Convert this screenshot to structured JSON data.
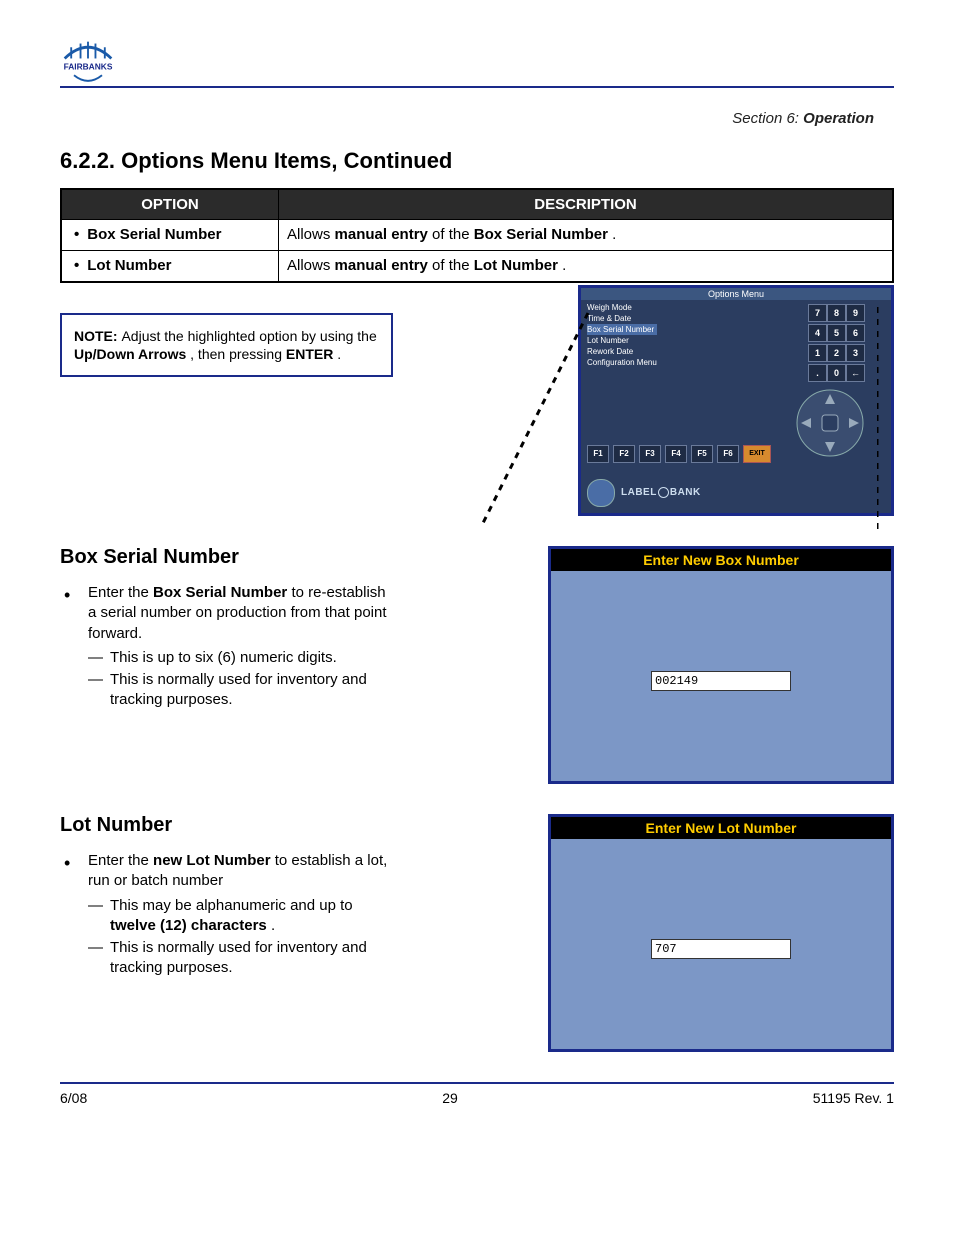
{
  "header": {
    "section": "Section 6:",
    "section_title": "Operation",
    "brand": "FAIRBANKS"
  },
  "options_title": "6.2.2. Options Menu Items, Continued",
  "table": {
    "head": [
      "OPTION",
      "DESCRIPTION"
    ],
    "rows": [
      {
        "opt": "Box Serial Number",
        "desc_pre": "Allows ",
        "desc_b": "manual entry ",
        "desc_mid": "of the ",
        "desc_b2": "Box Serial Number",
        "desc_post": "."
      },
      {
        "opt": "Lot Number",
        "desc_pre": "Allows ",
        "desc_b": "manual entry ",
        "desc_mid": "of the ",
        "desc_b2": "Lot Number",
        "desc_post": "."
      }
    ]
  },
  "note": {
    "lead": "NOTE: ",
    "text1": "Adjust the highlighted option by using the ",
    "b1": "Up/Down Arrows",
    "text2": ", then pressing ",
    "b2": "ENTER",
    "text3": "."
  },
  "device": {
    "title": "Options Menu",
    "menu": [
      "Weigh Mode",
      "Time & Date",
      "Box Serial Number",
      "Lot Number",
      "Rework Date",
      "Configuration Menu"
    ],
    "menu_hl_index": 2,
    "keypad": [
      "7",
      "8",
      "9",
      "4",
      "5",
      "6",
      "1",
      "2",
      "3",
      ".",
      "0",
      "←"
    ],
    "fkeys": [
      "F1",
      "F2",
      "F3",
      "F4",
      "F5",
      "F6"
    ],
    "exit": "EXIT",
    "brand": "LABEL BANK"
  },
  "dialog_box": {
    "title": "Enter New Box Number",
    "value": "002149"
  },
  "box_section": {
    "heading": "Box Serial Number",
    "line1_a": "Enter the ",
    "line1_b": "Box Serial Number",
    "line1_c": " to re-establish a serial number on production from that point forward.",
    "sub1": "This is up to six (6) numeric digits.",
    "sub2": "This is normally used for inventory and tracking purposes."
  },
  "dialog_lot": {
    "title": "Enter New Lot Number",
    "value": "707"
  },
  "lot_section": {
    "heading": "Lot Number",
    "line1_a": "Enter the ",
    "line1_b": "new Lot Number",
    "line1_c": " to establish a lot, run or batch number",
    "sub1a": "This may be alphanumeric and up to ",
    "sub1b": "twelve (12) characters",
    "sub1c": ".",
    "sub2": "This is normally used for inventory and tracking purposes."
  },
  "footer": {
    "left": "6/08",
    "center": "29",
    "right": "51195    Rev. 1"
  }
}
